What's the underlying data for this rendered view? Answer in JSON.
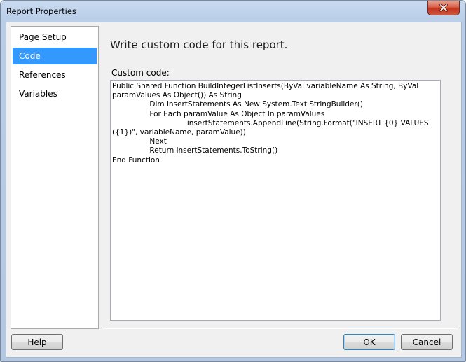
{
  "window": {
    "title": "Report Properties"
  },
  "nav": {
    "items": [
      {
        "label": "Page Setup",
        "selected": false
      },
      {
        "label": "Code",
        "selected": true
      },
      {
        "label": "References",
        "selected": false
      },
      {
        "label": "Variables",
        "selected": false
      }
    ]
  },
  "content": {
    "heading": "Write custom code for this report.",
    "code_label": "Custom code:",
    "code_text": "Public Shared Function BuildIntegerListInserts(ByVal variableName As String, ByVal paramValues As Object()) As String\n\t\tDim insertStatements As New System.Text.StringBuilder()\n\t\tFor Each paramValue As Object In paramValues\n\t\t\t\tinsertStatements.AppendLine(String.Format(\"INSERT {0} VALUES ({1})\", variableName, paramValue))\n\t\tNext\n\t\tReturn insertStatements.ToString()\nEnd Function"
  },
  "buttons": {
    "help": "Help",
    "ok": "OK",
    "cancel": "Cancel"
  },
  "icons": {
    "close": "close-icon"
  },
  "colors": {
    "selection": "#3399ff",
    "close_button": "#c2351c"
  }
}
